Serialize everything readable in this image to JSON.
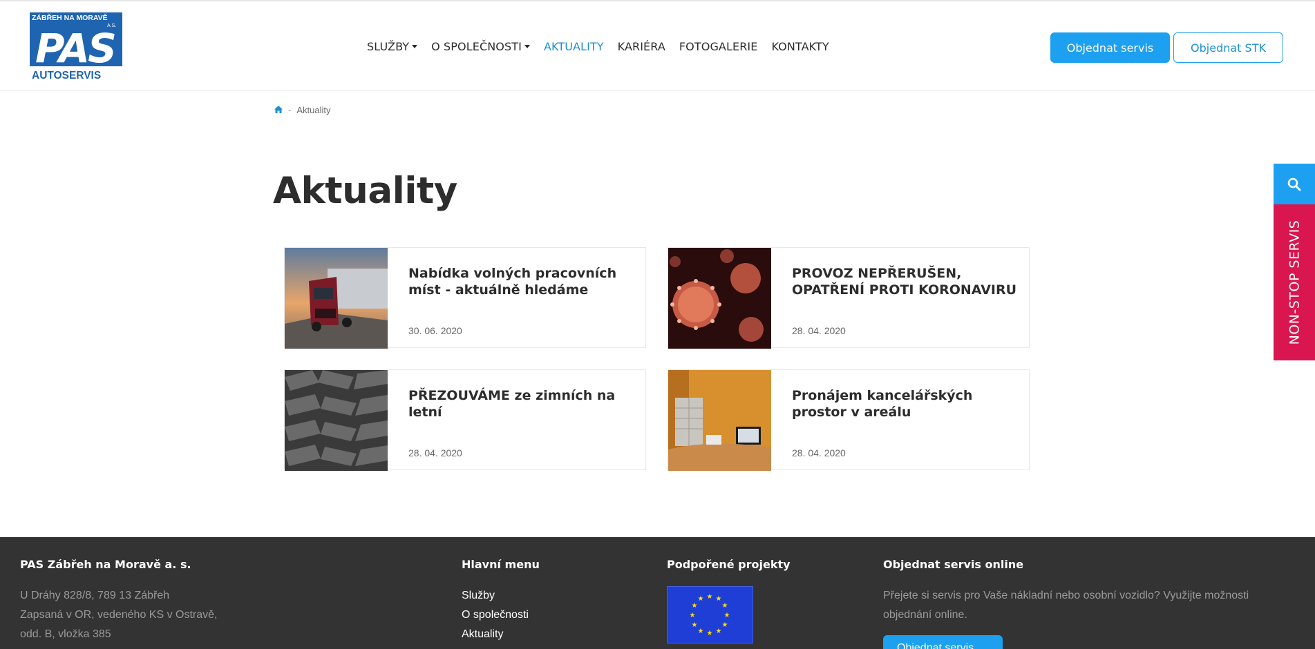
{
  "header": {
    "logo": {
      "top_text": "ZÁBŘEH NA MORAVĚ",
      "small_text": "A.S.",
      "mark": "PAS",
      "bottom_text": "AUTOSERVIS"
    },
    "nav": [
      {
        "label": "SLUŽBY",
        "dropdown": true
      },
      {
        "label": "O SPOLEČNOSTI",
        "dropdown": true
      },
      {
        "label": "AKTUALITY",
        "active": true
      },
      {
        "label": "KARIÉRA"
      },
      {
        "label": "FOTOGALERIE"
      },
      {
        "label": "KONTAKTY"
      }
    ],
    "cta_primary": "Objednat servis",
    "cta_secondary": "Objednat STK"
  },
  "breadcrumb": {
    "home_icon": "home-icon",
    "separator": "-",
    "current": "Aktuality"
  },
  "page_title": "Aktuality",
  "articles": [
    {
      "title": "Nabídka volných pracovních míst - aktuálně hledáme",
      "date": "30. 06. 2020",
      "image": "truck-photo"
    },
    {
      "title": "PROVOZ NEPŘERUŠEN, OPATŘENÍ PROTI KORONAVIRU",
      "date": "28. 04. 2020",
      "image": "virus-photo"
    },
    {
      "title": "PŘEZOUVÁME ze zimních na letní",
      "date": "28. 04. 2020",
      "image": "tire-photo"
    },
    {
      "title": "Pronájem kancelářských prostor v areálu",
      "date": "28. 04. 2020",
      "image": "office-photo"
    }
  ],
  "side": {
    "search_icon": "search-icon",
    "nonstop_label": "NON-STOP SERVIS"
  },
  "footer": {
    "company": {
      "heading": "PAS Zábřeh na Moravě a. s.",
      "lines": [
        "U Dráhy 828/8, 789 13 Zábřeh",
        "Zapsaná v OR, vedeného KS v Ostravě,",
        "odd. B, vložka 385"
      ]
    },
    "menu": {
      "heading": "Hlavní menu",
      "links": [
        "Služby",
        "O společnosti",
        "Aktuality"
      ]
    },
    "projects": {
      "heading": "Podpořené projekty",
      "image": "eu-flag"
    },
    "order": {
      "heading": "Objednat servis online",
      "text_lines": [
        "Přejete si servis pro Vaše nákladní nebo osobní vozidlo? Využijte možnosti",
        "objednání online."
      ],
      "button": "Objednat servis"
    }
  },
  "colors": {
    "accent": "#1ea0f0",
    "active_nav": "#1e8ed4",
    "nonstop": "#d9164f",
    "footer_bg": "#333333"
  }
}
